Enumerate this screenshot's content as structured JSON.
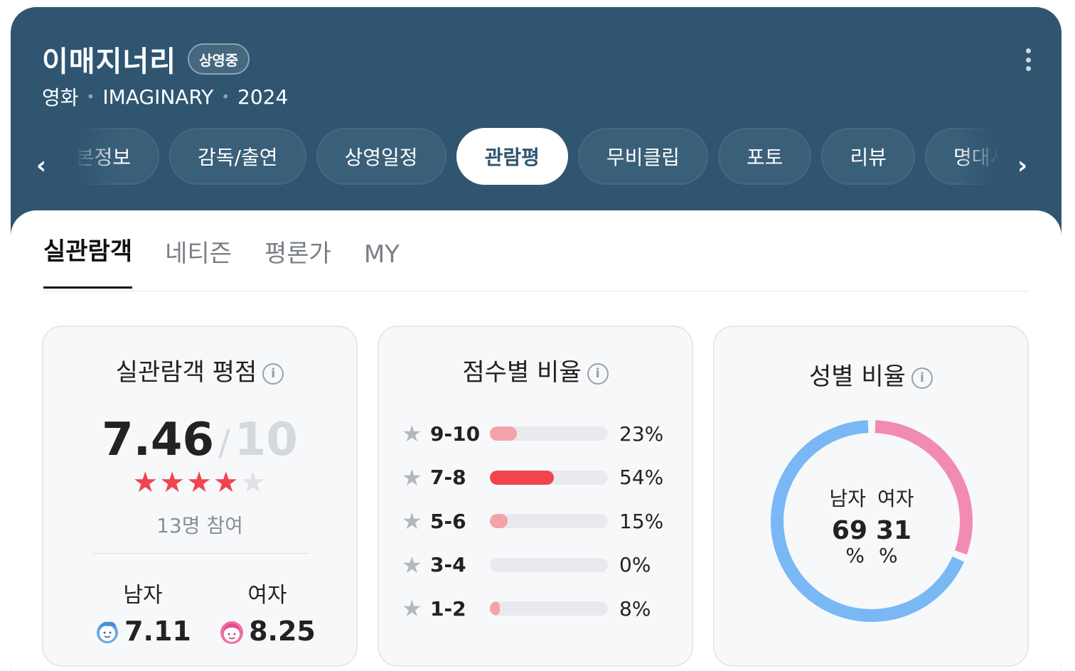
{
  "header": {
    "title": "이매지너리",
    "badge": "상영중",
    "category": "영화",
    "original_title": "IMAGINARY",
    "year": "2024",
    "tabs": [
      {
        "label": "기본정보"
      },
      {
        "label": "감독/출연"
      },
      {
        "label": "상영일정"
      },
      {
        "label": "관람평",
        "active": true
      },
      {
        "label": "무비클립"
      },
      {
        "label": "포토"
      },
      {
        "label": "리뷰"
      },
      {
        "label": "명대사"
      }
    ],
    "active_tab": "관람평"
  },
  "subtabs": [
    {
      "label": "실관람객",
      "active": true
    },
    {
      "label": "네티즌"
    },
    {
      "label": "평론가"
    },
    {
      "label": "MY"
    }
  ],
  "rating_panel": {
    "title": "실관람객 평점",
    "score": "7.46",
    "max": "10",
    "stars_filled": 4,
    "stars_total": 5,
    "participants": "13명 참여",
    "male_label": "남자",
    "male_score": "7.11",
    "female_label": "여자",
    "female_score": "8.25"
  },
  "distribution_panel": {
    "title": "점수별 비율",
    "rows": [
      {
        "range": "9-10",
        "percent": 23,
        "percent_label": "23%",
        "color": "#f4a3a8"
      },
      {
        "range": "7-8",
        "percent": 54,
        "percent_label": "54%",
        "color": "#f2444f"
      },
      {
        "range": "5-6",
        "percent": 15,
        "percent_label": "15%",
        "color": "#f4a3a8"
      },
      {
        "range": "3-4",
        "percent": 0,
        "percent_label": "0%",
        "color": "#f4a3a8"
      },
      {
        "range": "1-2",
        "percent": 8,
        "percent_label": "8%",
        "color": "#f4a3a8"
      }
    ]
  },
  "gender_panel": {
    "title": "성별 비율",
    "male_label": "남자",
    "female_label": "여자",
    "male_percent": "69",
    "female_percent": "31",
    "unit": "%",
    "male_color": "#79b8f4",
    "female_color": "#f28bb4"
  }
}
